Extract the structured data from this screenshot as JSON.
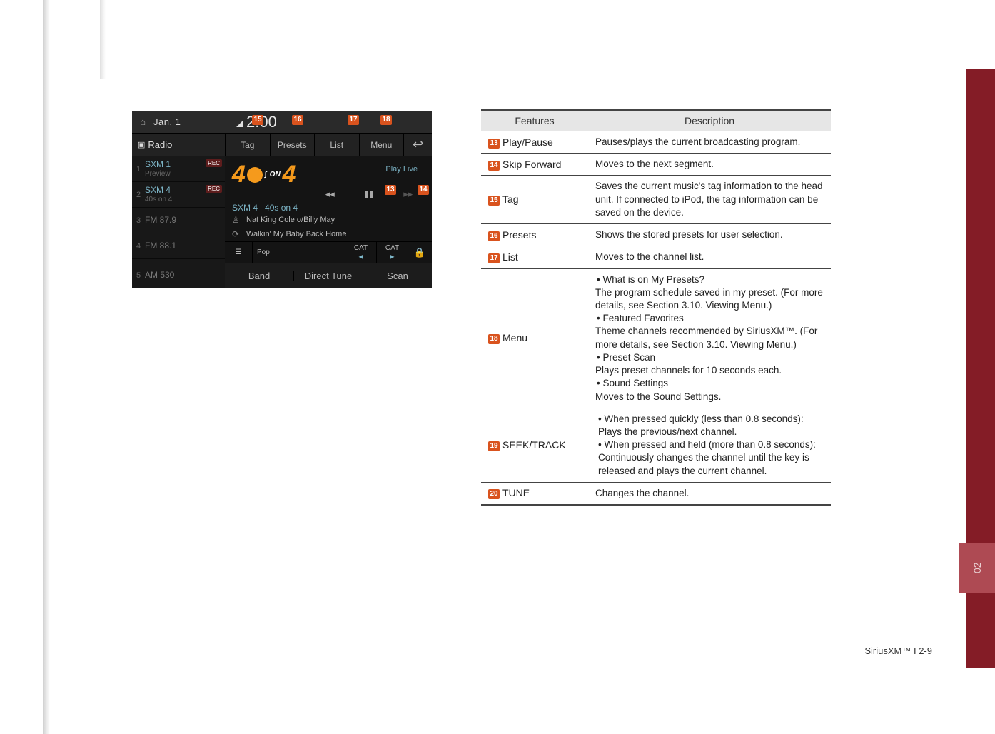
{
  "sideTab": "02",
  "footer": "SiriusXM™ I 2-9",
  "screen": {
    "date": "Jan.  1",
    "time": "2:00",
    "radioLabel": "Radio",
    "subButtons": {
      "tag": "Tag",
      "presets": "Presets",
      "list": "List",
      "menu": "Menu",
      "back": "↩"
    },
    "bandFoot": {
      "band": "Band",
      "direct": "Direct Tune",
      "scan": "Scan"
    },
    "presets": [
      {
        "n": "1",
        "main": "SXM 1",
        "sub": "Preview",
        "rec": "REC",
        "cls": ""
      },
      {
        "n": "2",
        "main": "SXM 4",
        "sub": "40s on 4",
        "rec": "REC",
        "cls": ""
      },
      {
        "n": "3",
        "main": "FM 87.9",
        "sub": "",
        "rec": "",
        "cls": "fm"
      },
      {
        "n": "4",
        "main": "FM 88.1",
        "sub": "",
        "rec": "",
        "cls": "fm"
      },
      {
        "n": "5",
        "main": "AM 530",
        "sub": "",
        "rec": "",
        "cls": "fm"
      }
    ],
    "playLive": "Play Live",
    "onText": "ON",
    "bigNumA": "4",
    "bigNumB": "4",
    "channelLine": {
      "ch": "SXM 4",
      "name": "40s on 4"
    },
    "meta1": "Nat King Cole o/Billy May",
    "meta2": "Walkin' My Baby Back Home",
    "catGenre": "Pop",
    "catLabel": "CAT",
    "transport": {
      "prev": "◂◂",
      "pause": "▮▮",
      "next": "▸▸"
    }
  },
  "callouts": {
    "c13": "13",
    "c14": "14",
    "c15": "15",
    "c16": "16",
    "c17": "17",
    "c18": "18"
  },
  "tableHead": {
    "features": "Features",
    "description": "Description"
  },
  "rows": {
    "r13": {
      "num": "13",
      "feat": "Play/Pause",
      "desc": "Pauses/plays the current broadcasting program."
    },
    "r14": {
      "num": "14",
      "feat": "Skip Forward",
      "desc": "Moves to the next segment."
    },
    "r15": {
      "num": "15",
      "feat": "Tag",
      "desc": "Saves the current music's tag information to the head unit. If connected to iPod, the tag information can be saved on the device."
    },
    "r16": {
      "num": "16",
      "feat": "Presets",
      "desc": "Shows the stored presets for user selection."
    },
    "r17": {
      "num": "17",
      "feat": "List",
      "desc": "Moves to the channel list."
    },
    "r18": {
      "num": "18",
      "feat": "Menu",
      "b1": "What is on My Presets?",
      "l1a": "The program schedule saved in my preset. (For more details, see Section 3.10. Viewing Menu.)",
      "b2": "Featured Favorites",
      "l2a": "Theme channels recommended by SiriusXM™. (For more details, see Section 3.10. Viewing Menu.)",
      "b3": "Preset Scan",
      "l3a": "Plays preset channels for 10 seconds each.",
      "b4": "Sound Settings",
      "l4a": "Moves to the Sound Settings."
    },
    "r19": {
      "num": "19",
      "feat": "SEEK/TRACK",
      "b1": "When pressed quickly (less than 0.8 seconds): Plays the previous/next channel.",
      "b2": "When pressed and held (more than 0.8 seconds): Continuously changes the channel until the key is released and plays the current channel."
    },
    "r20": {
      "num": "20",
      "feat": "TUNE",
      "desc": "Changes the channel."
    }
  }
}
